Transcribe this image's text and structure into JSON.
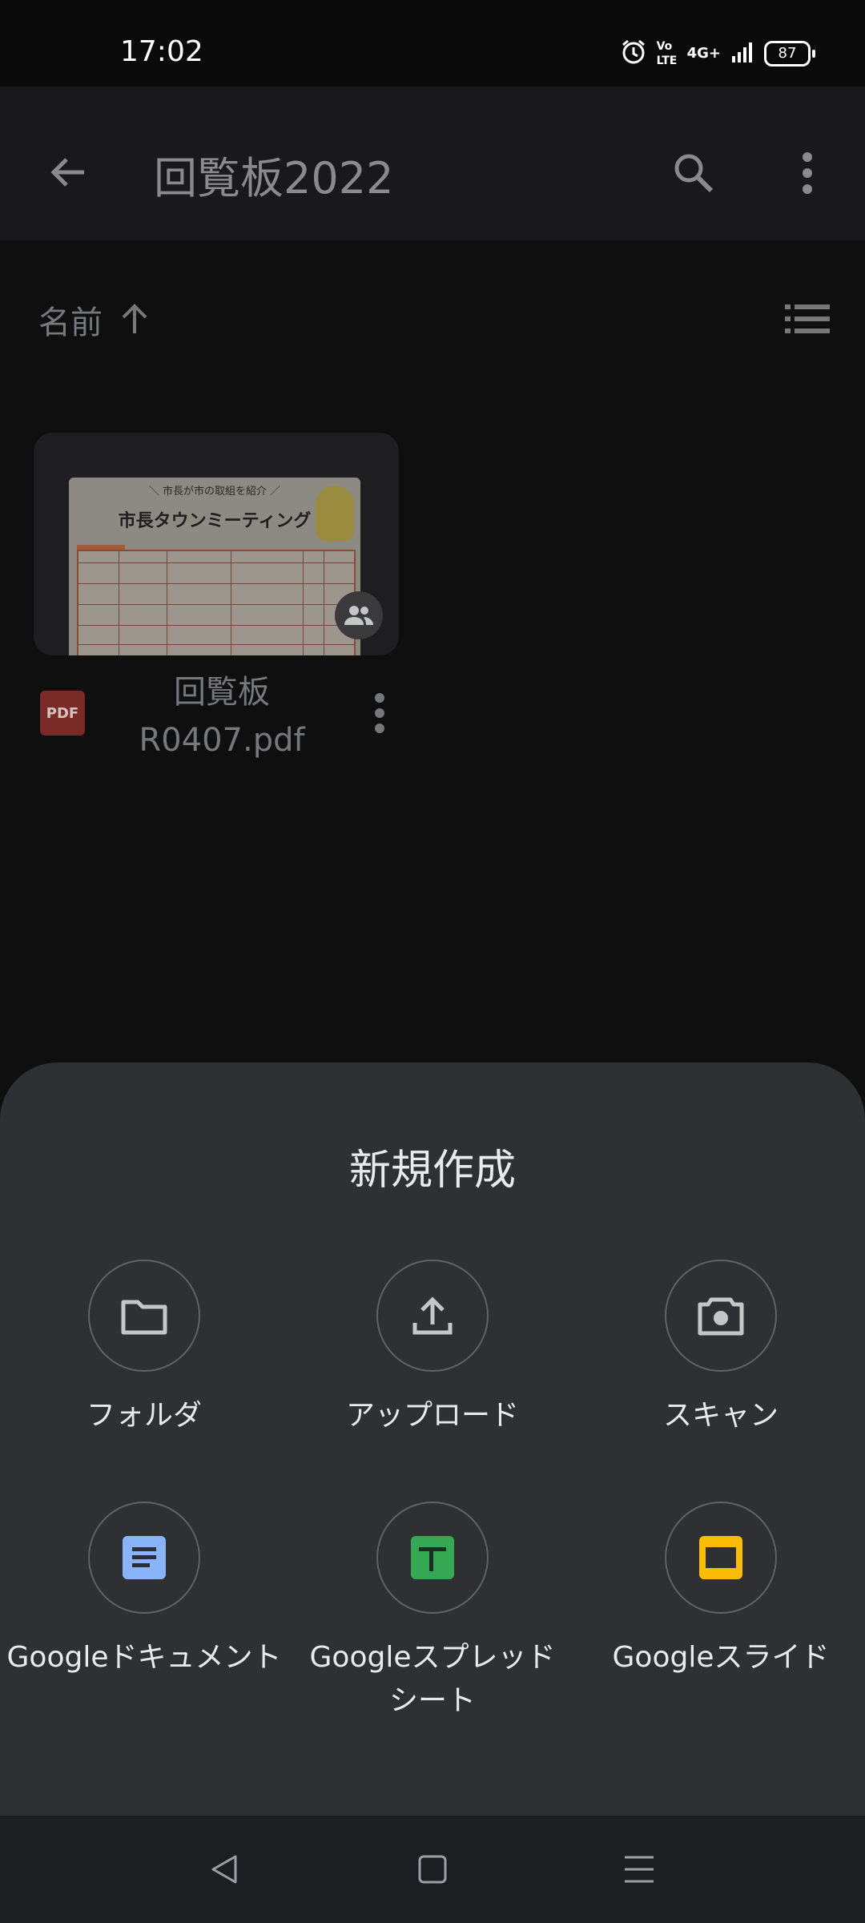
{
  "status_bar": {
    "time": "17:02",
    "volte": "Vo LTE",
    "network": "4G+",
    "battery": "87",
    "icons": [
      "alarm-icon",
      "volte-icon",
      "signal-icon",
      "battery-icon"
    ]
  },
  "app_bar": {
    "title": "回覧板2022",
    "icons": [
      "back-arrow-icon",
      "search-icon",
      "more-vert-icon"
    ]
  },
  "sort": {
    "label": "名前",
    "direction_icon": "arrow-up-icon",
    "view_toggle_icon": "list-view-icon"
  },
  "file": {
    "type_badge": "PDF",
    "name": "回覧板 R0407.pdf",
    "thumbnail": {
      "header_small": "＼ 市長が市の取組を紹介 ／",
      "header_large": "市長タウンミーティング"
    },
    "shared_icon": "people-icon",
    "more_icon": "more-vert-icon"
  },
  "sheet": {
    "title": "新規作成",
    "actions": [
      {
        "label": "フォルダ",
        "icon": "folder-icon"
      },
      {
        "label": "アップロード",
        "icon": "upload-icon"
      },
      {
        "label": "スキャン",
        "icon": "camera-icon"
      },
      {
        "label": "Googleドキュメント",
        "icon": "docs-icon",
        "color": "#8ab4f8"
      },
      {
        "label": "Googleスプレッドシート",
        "icon": "sheets-icon",
        "color": "#34a853"
      },
      {
        "label": "Googleスライド",
        "icon": "slides-icon",
        "color": "#fbbc04"
      }
    ]
  },
  "nav_bar": {
    "icons": [
      "nav-back-icon",
      "nav-home-icon",
      "nav-recents-icon"
    ]
  }
}
